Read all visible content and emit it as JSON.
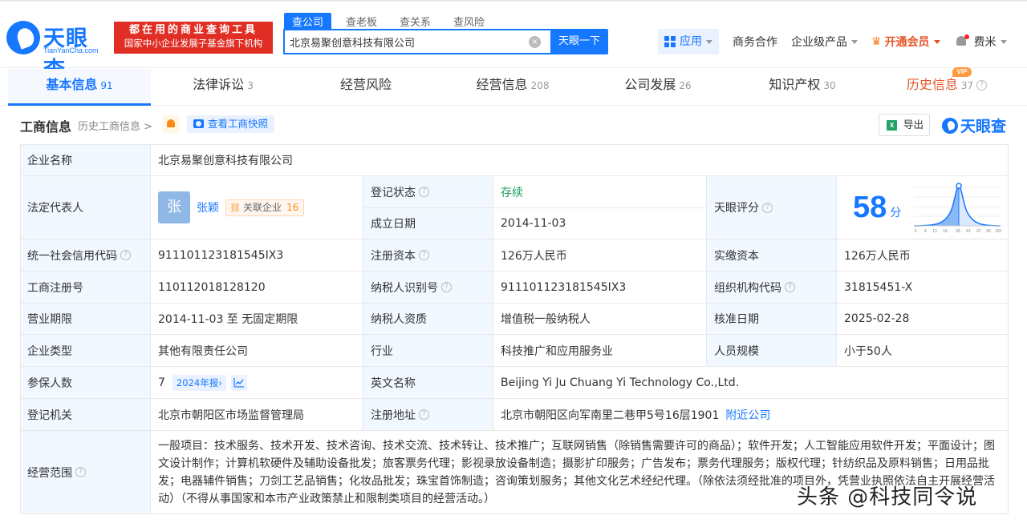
{
  "header": {
    "logo_name": "天眼查",
    "logo_sub": "TianYanCha.com",
    "badge_line1": "都在用的商业查询工具",
    "badge_line2": "国家中小企业发展子基金旗下机构",
    "search_tabs": [
      "查公司",
      "查老板",
      "查关系",
      "查风险"
    ],
    "search_value": "北京易聚创意科技有限公司",
    "search_button": "天眼一下",
    "nav": {
      "app": "应用",
      "business": "商务合作",
      "enterprise": "企业级产品",
      "vip": "开通会员",
      "user": "费米"
    }
  },
  "tabs": [
    {
      "label": "基本信息",
      "count": "91"
    },
    {
      "label": "法律诉讼",
      "count": "3"
    },
    {
      "label": "经营风险",
      "count": ""
    },
    {
      "label": "经营信息",
      "count": "208"
    },
    {
      "label": "公司发展",
      "count": "26"
    },
    {
      "label": "知识产权",
      "count": "30"
    },
    {
      "label": "历史信息",
      "count": "37"
    }
  ],
  "vip_tag": "VIP",
  "section": {
    "title": "工商信息",
    "history_link": "历史工商信息",
    "snapshot_button": "查看工商快照",
    "export_button": "导出",
    "export_icon": "X",
    "brand": "天眼查"
  },
  "info": {
    "company_name_label": "企业名称",
    "company_name": "北京易聚创意科技有限公司",
    "legal_rep_label": "法定代表人",
    "legal_rep_avatar": "张",
    "legal_rep_name": "张颖",
    "assoc_label": "关联企业",
    "assoc_count": "16",
    "reg_status_label": "登记状态",
    "reg_status": "存续",
    "founded_label": "成立日期",
    "founded": "2014-11-03",
    "tianyan_score_label": "天眼评分",
    "tianyan_score": "58",
    "score_unit": "分",
    "score_axis": [
      "0",
      "3",
      "13",
      "18",
      "58",
      "81",
      "97",
      "99",
      "100"
    ],
    "credit_code_label": "统一社会信用代码",
    "credit_code": "911101123181545IX3",
    "reg_capital_label": "注册资本",
    "reg_capital": "126万人民币",
    "paid_capital_label": "实缴资本",
    "paid_capital": "126万人民币",
    "reg_no_label": "工商注册号",
    "reg_no": "110112018128120",
    "taxpayer_id_label": "纳税人识别号",
    "taxpayer_id": "911101123181545IX3",
    "org_code_label": "组织机构代码",
    "org_code": "31815451-X",
    "term_label": "营业期限",
    "term": "2014-11-03 至 无固定期限",
    "taxpayer_qual_label": "纳税人资质",
    "taxpayer_qual": "增值税一般纳税人",
    "approval_date_label": "核准日期",
    "approval_date": "2025-02-28",
    "company_type_label": "企业类型",
    "company_type": "其他有限责任公司",
    "industry_label": "行业",
    "industry": "科技推广和应用服务业",
    "staff_size_label": "人员规模",
    "staff_size": "小于50人",
    "insured_label": "参保人数",
    "insured": "7",
    "insured_report": "2024年报",
    "english_name_label": "英文名称",
    "english_name": "Beijing Yi Ju Chuang Yi Technology Co.,Ltd.",
    "authority_label": "登记机关",
    "authority": "北京市朝阳区市场监督管理局",
    "address_label": "注册地址",
    "address": "北京市朝阳区向军南里二巷甲5号16层1901",
    "nearby_link": "附近公司",
    "scope_label": "经营范围",
    "scope": "一般项目：技术服务、技术开发、技术咨询、技术交流、技术转让、技术推广；互联网销售（除销售需要许可的商品）；软件开发；人工智能应用软件开发；平面设计；图文设计制作；计算机软硬件及辅助设备批发；旅客票务代理；影视录放设备制造；摄影扩印服务；广告发布；票务代理服务；版权代理；针纺织品及原料销售；日用品批发；电器辅件销售；刀剑工艺品销售；化妆品批发；珠宝首饰制造；咨询策划服务；其他文化艺术经纪代理。（除依法须经批准的项目外，凭营业执照依法自主开展经营活动）（不得从事国家和本市产业政策禁止和限制类项目的经营活动。）"
  },
  "watermark": "头条 @科技同令说",
  "colors": {
    "brand": "#1677ff",
    "label_bg": "#f2f8ff",
    "status_green": "#19a15f",
    "vip_orange": "#e5572b",
    "badge_red": "#e02e24"
  }
}
